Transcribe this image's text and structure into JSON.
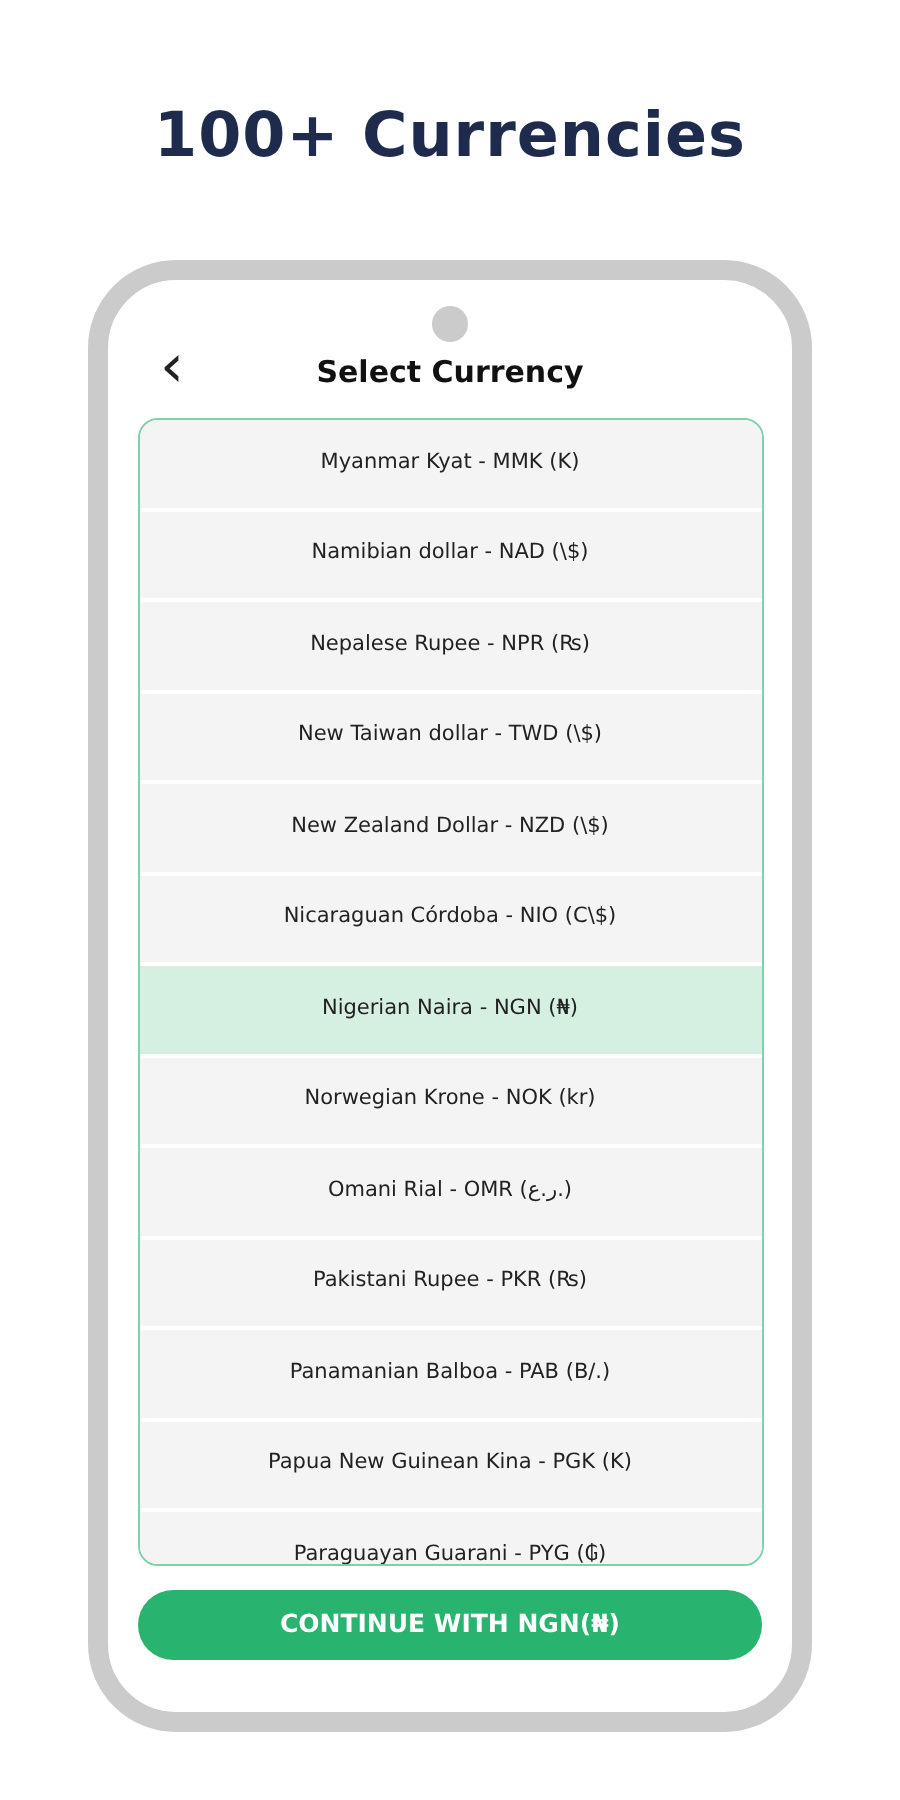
{
  "headline": "100+ Currencies",
  "screen": {
    "back_icon": "‹",
    "title": "Select Currency",
    "currencies": [
      {
        "label": "Myanmar Kyat - MMK (K)",
        "selected": false
      },
      {
        "label": "Namibian dollar - NAD (\\$)",
        "selected": false
      },
      {
        "label": "Nepalese Rupee - NPR (₨)",
        "selected": false
      },
      {
        "label": "New Taiwan dollar - TWD (\\$)",
        "selected": false
      },
      {
        "label": "New Zealand Dollar - NZD (\\$)",
        "selected": false
      },
      {
        "label": "Nicaraguan Córdoba - NIO (C\\$)",
        "selected": false
      },
      {
        "label": "Nigerian Naira - NGN (₦)",
        "selected": true
      },
      {
        "label": "Norwegian Krone - NOK (kr)",
        "selected": false
      },
      {
        "label": "Omani Rial - OMR (ر.ع.)",
        "selected": false
      },
      {
        "label": "Pakistani Rupee - PKR (₨)",
        "selected": false
      },
      {
        "label": "Panamanian Balboa - PAB (B/.)",
        "selected": false
      },
      {
        "label": "Papua New Guinean Kina - PGK (K)",
        "selected": false
      },
      {
        "label": "Paraguayan Guarani - PYG (₲)",
        "selected": false
      }
    ],
    "continue_button": "CONTINUE WITH NGN(₦)"
  }
}
